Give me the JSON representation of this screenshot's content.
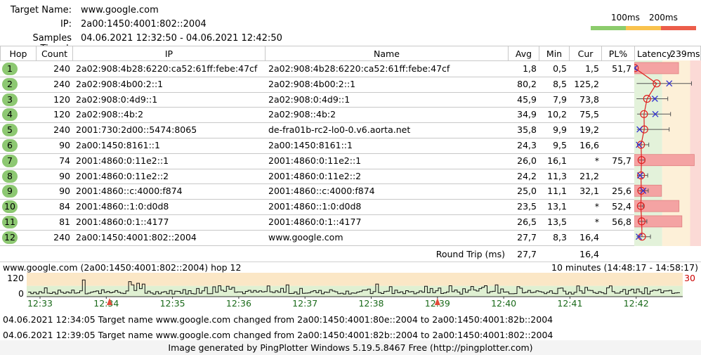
{
  "header": {
    "target_label": "Target Name:",
    "target_value": "www.google.com",
    "ip_label": "IP:",
    "ip_value": "2a00:1450:4001:802::2004",
    "samples_label": "Samples Timed:",
    "samples_value": "04.06.2021 12:32:50 - 04.06.2021 12:42:50",
    "scale_100": "100ms",
    "scale_200": "200ms"
  },
  "colors": {
    "good": "#8ccc6c",
    "warn": "#f9c24d",
    "bad": "#ec5d4a",
    "hop_badge": "#8dc872",
    "pl_bar": "#f4a3a3",
    "timeline_bg": "#dff0d2",
    "timeline_warn": "#fbe7c6",
    "line": "#e02020",
    "marker_cur": "#3030d0"
  },
  "columns": {
    "hop": "Hop",
    "count": "Count",
    "ip": "IP",
    "name": "Name",
    "avg": "Avg",
    "min": "Min",
    "cur": "Cur",
    "pl": "PL%",
    "latency": "Latency",
    "latency_max": "239ms"
  },
  "hops": [
    {
      "hop": "1",
      "count": "240",
      "ip": "2a02:908:4b28:6220:ca52:61ff:febe:47cf",
      "name": "2a02:908:4b28:6220:ca52:61ff:febe:47cf",
      "avg": "1,8",
      "min": "0,5",
      "cur": "1,5",
      "pl": "51,7",
      "avg_ms": 1.8,
      "min_ms": 0.5,
      "cur_ms": 1.5,
      "max_ms": 3,
      "pl_pct": 51.7
    },
    {
      "hop": "2",
      "count": "240",
      "ip": "2a02:908:4b00:2::1",
      "name": "2a02:908:4b00:2::1",
      "avg": "80,2",
      "min": "8,5",
      "cur": "125,2",
      "pl": "",
      "avg_ms": 80.2,
      "min_ms": 8.5,
      "cur_ms": 125.2,
      "max_ms": 205,
      "pl_pct": 0
    },
    {
      "hop": "3",
      "count": "120",
      "ip": "2a02:908:0:4d9::1",
      "name": "2a02:908:0:4d9::1",
      "avg": "45,9",
      "min": "7,9",
      "cur": "73,8",
      "pl": "",
      "avg_ms": 45.9,
      "min_ms": 7.9,
      "cur_ms": 73.8,
      "max_ms": 120,
      "pl_pct": 0
    },
    {
      "hop": "4",
      "count": "120",
      "ip": "2a02:908::4b:2",
      "name": "2a02:908::4b:2",
      "avg": "34,9",
      "min": "10,2",
      "cur": "75,5",
      "pl": "",
      "avg_ms": 34.9,
      "min_ms": 10.2,
      "cur_ms": 75.5,
      "max_ms": 130,
      "pl_pct": 0
    },
    {
      "hop": "5",
      "count": "240",
      "ip": "2001:730:2d00::5474:8065",
      "name": "de-fra01b-rc2-lo0-0.v6.aorta.net",
      "avg": "35,8",
      "min": "9,9",
      "cur": "19,2",
      "pl": "",
      "avg_ms": 35.8,
      "min_ms": 9.9,
      "cur_ms": 19.2,
      "max_ms": 125,
      "pl_pct": 0
    },
    {
      "hop": "6",
      "count": "90",
      "ip": "2a00:1450:8161::1",
      "name": "2a00:1450:8161::1",
      "avg": "24,3",
      "min": "9,5",
      "cur": "16,6",
      "pl": "",
      "avg_ms": 24.3,
      "min_ms": 9.5,
      "cur_ms": 16.6,
      "max_ms": 52,
      "pl_pct": 0
    },
    {
      "hop": "7",
      "count": "74",
      "ip": "2001:4860:0:11e2::1",
      "name": "2001:4860:0:11e2::1",
      "avg": "26,0",
      "min": "16,1",
      "cur": "*",
      "pl": "75,7",
      "avg_ms": 26.0,
      "min_ms": 16.1,
      "cur_ms": null,
      "max_ms": 38,
      "pl_pct": 75.7
    },
    {
      "hop": "8",
      "count": "90",
      "ip": "2001:4860:0:11e2::2",
      "name": "2001:4860:0:11e2::2",
      "avg": "24,2",
      "min": "11,3",
      "cur": "21,2",
      "pl": "",
      "avg_ms": 24.2,
      "min_ms": 11.3,
      "cur_ms": 21.2,
      "max_ms": 48,
      "pl_pct": 0
    },
    {
      "hop": "9",
      "count": "90",
      "ip": "2001:4860::c:4000:f874",
      "name": "2001:4860::c:4000:f874",
      "avg": "25,0",
      "min": "11,1",
      "cur": "32,1",
      "pl": "25,6",
      "avg_ms": 25.0,
      "min_ms": 11.1,
      "cur_ms": 32.1,
      "max_ms": 50,
      "pl_pct": 25.6
    },
    {
      "hop": "10",
      "count": "84",
      "ip": "2001:4860::1:0:d0d8",
      "name": "2001:4860::1:0:d0d8",
      "avg": "23,5",
      "min": "13,1",
      "cur": "*",
      "pl": "52,4",
      "avg_ms": 23.5,
      "min_ms": 13.1,
      "cur_ms": null,
      "max_ms": 32,
      "pl_pct": 52.4
    },
    {
      "hop": "11",
      "count": "81",
      "ip": "2001:4860:0:1::4177",
      "name": "2001:4860:0:1::4177",
      "avg": "26,5",
      "min": "13,5",
      "cur": "*",
      "pl": "56,8",
      "avg_ms": 26.5,
      "min_ms": 13.5,
      "cur_ms": null,
      "max_ms": 45,
      "pl_pct": 56.8
    },
    {
      "hop": "12",
      "count": "240",
      "ip": "2a00:1450:4001:802::2004",
      "name": "www.google.com",
      "avg": "27,7",
      "min": "8,3",
      "cur": "16,4",
      "pl": "",
      "avg_ms": 27.7,
      "min_ms": 8.3,
      "cur_ms": 16.4,
      "max_ms": 58,
      "pl_pct": 0
    }
  ],
  "round_trip": {
    "label": "Round Trip (ms)",
    "avg": "27,7",
    "cur": "16,4"
  },
  "timeline": {
    "title": "www.google.com (2a00:1450:4001:802::2004) hop 12",
    "range": "10 minutes (14:48:17 - 14:58:17)",
    "y_max": "120",
    "y_min": "0",
    "right_value": "30",
    "ticks": [
      "12:33",
      "12:34",
      "12:35",
      "12:36",
      "12:37",
      "12:38",
      "12:39",
      "12:40",
      "12:41",
      "12:42"
    ],
    "loss_marks": [
      1.05,
      6.0
    ]
  },
  "events": [
    "04.06.2021 12:34:05 Target name www.google.com changed from 2a00:1450:4001:80e::2004 to 2a00:1450:4001:82b::2004",
    "04.06.2021 12:39:05 Target name www.google.com changed from 2a00:1450:4001:82b::2004 to 2a00:1450:4001:802::2004"
  ],
  "footer": "Image generated by PingPlotter Windows 5.19.5.8467 Free (http://pingplotter.com)"
}
